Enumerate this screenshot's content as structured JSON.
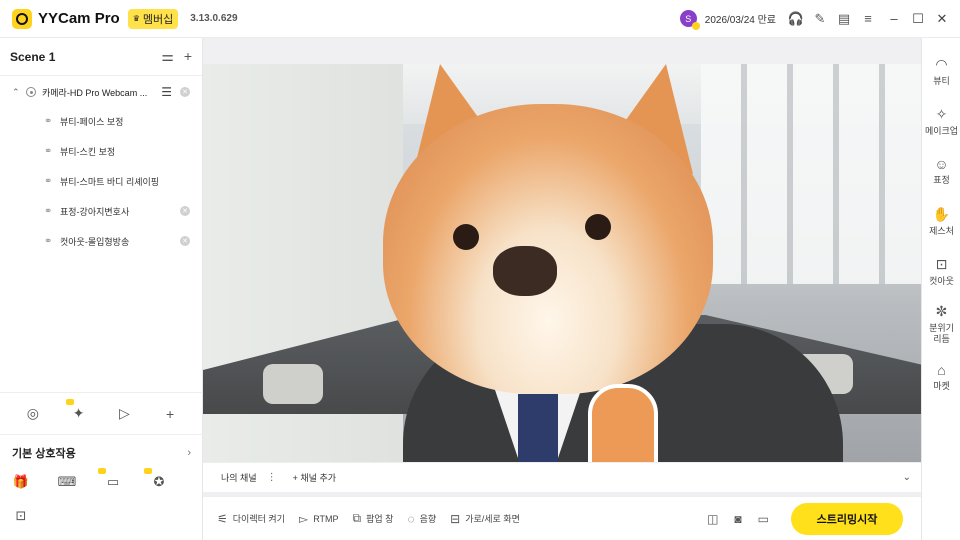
{
  "titlebar": {
    "app_name": "YYCam Pro",
    "member_badge": "멤버십",
    "version": "3.13.0.629",
    "avatar_letter": "S",
    "expiry": "2026/03/24 만료"
  },
  "scene": {
    "title": "Scene 1",
    "main_source": "카메라-HD Pro Webcam ...",
    "sub_items": [
      {
        "label": "뷰티-페이스 보정"
      },
      {
        "label": "뷰티-스킨 보정"
      },
      {
        "label": "뷰티-스마트 바디 리셰이핑"
      },
      {
        "label": "표정-강아지변호사"
      },
      {
        "label": "컷아웃-몰입형방송"
      }
    ]
  },
  "interaction": {
    "title": "기본 상호작용"
  },
  "channel_bar": {
    "my_channel": "나의 채널",
    "add_channel": "채널 추가"
  },
  "bottom_bar": {
    "director": "다이렉터 켜기",
    "rtmp": "RTMP",
    "popup": "팝업 창",
    "audio": "음향",
    "orientation": "가로/세로 화면",
    "stream_button": "스트리밍시작"
  },
  "right_panel": {
    "items": [
      {
        "label": "뷰티",
        "icon": "beauty-icon"
      },
      {
        "label": "메이크업",
        "icon": "makeup-icon"
      },
      {
        "label": "표정",
        "icon": "expression-icon"
      },
      {
        "label": "제스처",
        "icon": "gesture-icon"
      },
      {
        "label": "컷아웃",
        "icon": "cutout-icon"
      },
      {
        "label": "분위기\n리듬",
        "icon": "atmosphere-icon"
      },
      {
        "label": "마켓",
        "icon": "market-icon"
      }
    ]
  },
  "colors": {
    "accent": "#ffe01b",
    "avatar": "#8a3fc9"
  }
}
